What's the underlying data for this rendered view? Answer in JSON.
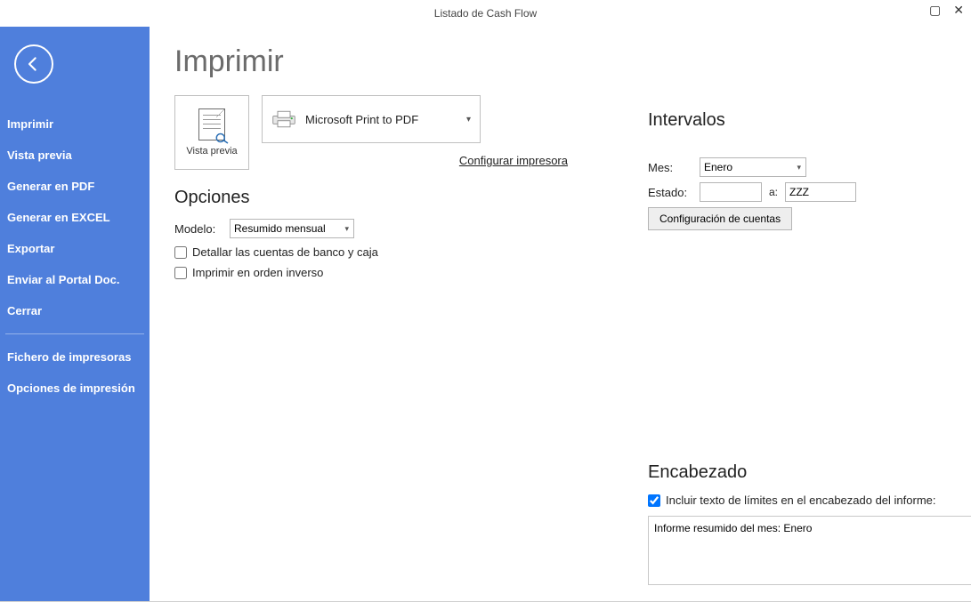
{
  "window": {
    "title": "Listado de Cash Flow"
  },
  "sidebar": {
    "items": [
      "Imprimir",
      "Vista previa",
      "Generar en PDF",
      "Generar en EXCEL",
      "Exportar",
      "Enviar al Portal Doc.",
      "Cerrar"
    ],
    "secondary": [
      "Fichero de impresoras",
      "Opciones de impresión"
    ]
  },
  "main": {
    "title": "Imprimir",
    "preview_label": "Vista previa",
    "printer": {
      "selected": "Microsoft Print to PDF",
      "configure_link": "Configurar impresora"
    },
    "opciones": {
      "title": "Opciones",
      "modelo_label": "Modelo:",
      "modelo_value": "Resumido mensual",
      "chk_detallar": "Detallar las cuentas de banco y caja",
      "chk_inverso": "Imprimir en orden inverso"
    },
    "intervalos": {
      "title": "Intervalos",
      "mes_label": "Mes:",
      "mes_value": "Enero",
      "estado_label": "Estado:",
      "estado_from": "",
      "estado_a_label": "a:",
      "estado_to": "ZZZ",
      "config_btn": "Configuración de cuentas"
    },
    "encabezado": {
      "title": "Encabezado",
      "chk_incluir": "Incluir texto de límites en el encabezado del informe:",
      "text": "Informe resumido del mes: Enero"
    }
  }
}
